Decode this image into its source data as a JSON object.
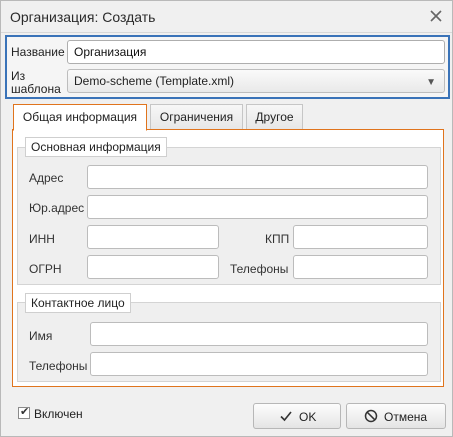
{
  "window": {
    "title": "Организация: Создать",
    "close_icon": "close-icon"
  },
  "header_form": {
    "name_label": "Название",
    "name_value": "Организация",
    "template_label_line1": "Из",
    "template_label_line2": "шаблона",
    "template_selected": "Demo-scheme (Template.xml)",
    "highlight_color": "#3a73b8"
  },
  "tabs": [
    {
      "label": "Общая информация",
      "active": true
    },
    {
      "label": "Ограничения",
      "active": false
    },
    {
      "label": "Другое",
      "active": false
    }
  ],
  "accent_color": "#e0741d",
  "main_info": {
    "legend": "Основная информация",
    "address_label": "Адрес",
    "address_value": "",
    "legal_address_label": "Юр.адрес",
    "legal_address_value": "",
    "inn_label": "ИНН",
    "inn_value": "",
    "kpp_label": "КПП",
    "kpp_value": "",
    "ogrn_label": "ОГРН",
    "ogrn_value": "",
    "phones_label": "Телефоны",
    "phones_value": ""
  },
  "contact": {
    "legend": "Контактное лицо",
    "name_label": "Имя",
    "name_value": "",
    "phones_label": "Телефоны",
    "phones_value": ""
  },
  "footer": {
    "enabled_label": "Включен",
    "enabled_checked": true,
    "ok_label": "OK",
    "cancel_label": "Отмена"
  }
}
